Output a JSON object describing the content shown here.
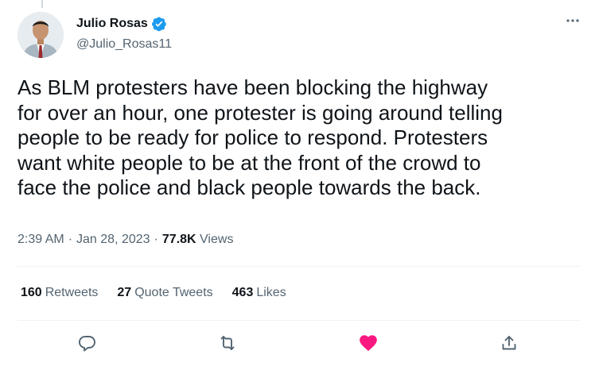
{
  "author": {
    "display_name": "Julio Rosas",
    "handle": "@Julio_Rosas11",
    "verified_icon": "verified-badge-icon"
  },
  "tweet": {
    "text_lines": [
      "As BLM protesters have been blocking the highway",
      "for over an hour, one protester is going around telling",
      "people to be ready for police to respond. Protesters",
      "want white people to be at the front of the crowd to",
      "face the police and black people towards the back."
    ]
  },
  "meta": {
    "time": "2:39 AM",
    "sep1": "·",
    "date": "Jan 28, 2023",
    "sep2": "·",
    "views_count": "77.8K",
    "views_label": "Views"
  },
  "stats": [
    {
      "count": "160",
      "label": "Retweets"
    },
    {
      "count": "27",
      "label": "Quote Tweets"
    },
    {
      "count": "463",
      "label": "Likes"
    }
  ],
  "actions": {
    "reply_icon": "reply-icon",
    "retweet_icon": "retweet-icon",
    "like_icon": "heart-icon",
    "share_icon": "share-icon",
    "more_icon": "more-icon"
  },
  "colors": {
    "verified": "#1d9bf0",
    "like_active": "#f91880",
    "text": "#0f1419",
    "secondary": "#536471"
  }
}
